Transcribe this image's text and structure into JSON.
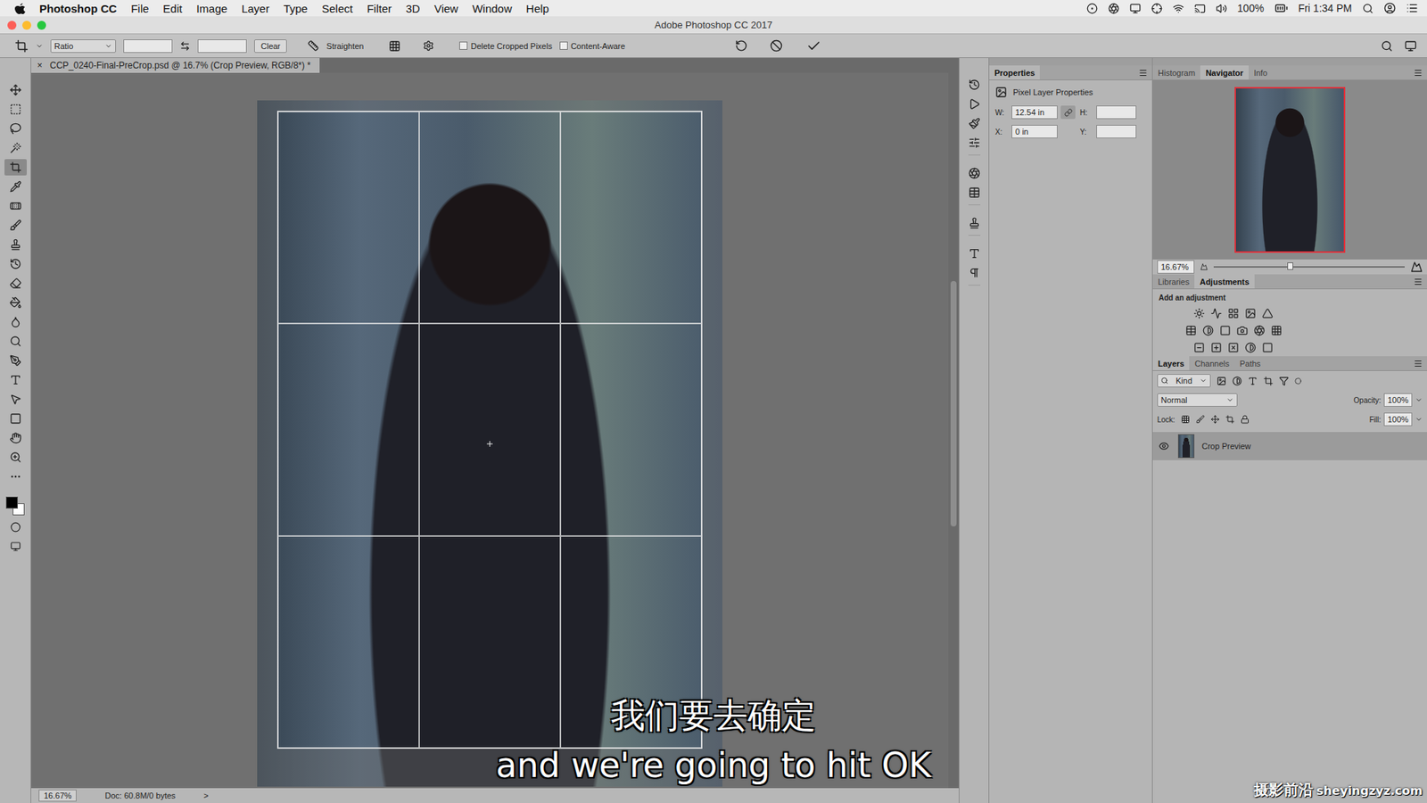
{
  "menubar": {
    "app": "Photoshop CC",
    "items": [
      "File",
      "Edit",
      "Image",
      "Layer",
      "Type",
      "Select",
      "Filter",
      "3D",
      "View",
      "Window",
      "Help"
    ],
    "battery": "100%",
    "clock": "Fri 1:34 PM"
  },
  "window": {
    "title": "Adobe Photoshop CC 2017"
  },
  "options": {
    "preset": "Ratio",
    "width": "",
    "height": "",
    "clear": "Clear",
    "straighten": "Straighten",
    "checkboxes": [
      {
        "label": "Delete Cropped Pixels",
        "checked": false
      },
      {
        "label": "Content-Aware",
        "checked": false
      }
    ]
  },
  "document": {
    "close": "×",
    "tab": "CCP_0240-Final-PreCrop.psd @ 16.7% (Crop Preview, RGB/8*) *"
  },
  "tools": [
    {
      "kind": "move",
      "selected": false
    },
    {
      "kind": "marquee",
      "selected": false
    },
    {
      "kind": "lasso",
      "selected": false
    },
    {
      "kind": "wand",
      "selected": false
    },
    {
      "kind": "crop",
      "selected": true
    },
    {
      "kind": "eyedropper",
      "selected": false
    },
    {
      "kind": "healing",
      "selected": false
    },
    {
      "kind": "brush",
      "selected": false
    },
    {
      "kind": "stamp",
      "selected": false
    },
    {
      "kind": "history",
      "selected": false
    },
    {
      "kind": "eraser",
      "selected": false
    },
    {
      "kind": "bucket",
      "selected": false
    },
    {
      "kind": "blur",
      "selected": false
    },
    {
      "kind": "dodge",
      "selected": false
    },
    {
      "kind": "pen",
      "selected": false
    },
    {
      "kind": "type",
      "selected": false
    },
    {
      "kind": "select",
      "selected": false
    },
    {
      "kind": "rectangle",
      "selected": false
    },
    {
      "kind": "hand",
      "selected": false
    },
    {
      "kind": "zoom",
      "selected": false
    },
    {
      "kind": "more",
      "selected": false
    }
  ],
  "status": {
    "zoom": "16.67%",
    "doc": "Doc: 60.8M/0 bytes",
    "more": ">"
  },
  "properties": {
    "title": "Properties",
    "subtitle": "Pixel Layer Properties",
    "fields": [
      {
        "label": "W:",
        "value": "12.54 in"
      },
      {
        "label": "H:",
        "value": ""
      },
      {
        "label": "X:",
        "value": "0 in"
      },
      {
        "label": "Y:",
        "value": ""
      }
    ]
  },
  "navigator": {
    "tabs": [
      {
        "label": "Histogram",
        "selected": false
      },
      {
        "label": "Navigator",
        "selected": true
      },
      {
        "label": "Info",
        "selected": false
      }
    ],
    "zoom": "16.67%",
    "level": 0.4
  },
  "adjustments": {
    "tabs": [
      {
        "label": "Libraries",
        "selected": false
      },
      {
        "label": "Adjustments",
        "selected": true
      }
    ],
    "hint": "Add an adjustment"
  },
  "layers": {
    "tabs": [
      {
        "label": "Layers",
        "selected": true
      },
      {
        "label": "Channels",
        "selected": false
      },
      {
        "label": "Paths",
        "selected": false
      }
    ],
    "filter": "Kind",
    "blend": "Normal",
    "opacity_label": "Opacity:",
    "opacity": "100%",
    "lock_label": "Lock:",
    "fill_label": "Fill:",
    "fill": "100%",
    "items": [
      {
        "name": "Crop Preview",
        "visible": true,
        "selected": true
      }
    ]
  },
  "subtitles": [
    "我们要去确定",
    "and we're going to hit OK"
  ],
  "watermark": {
    "brand": "摄影前沿",
    "site": "sheyingzyz.com"
  }
}
